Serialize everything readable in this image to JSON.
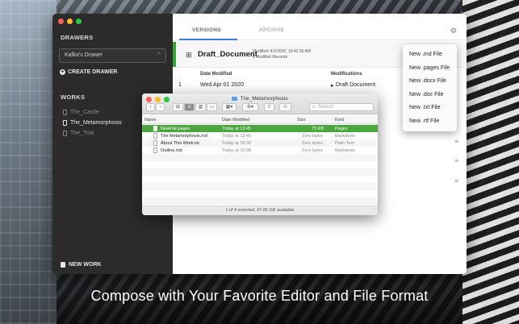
{
  "sidebar": {
    "drawers_heading": "DRAWERS",
    "drawer_selected": "Kafka's Drawer",
    "create_drawer": "CREATE DRAWER",
    "works_heading": "WORKS",
    "works": [
      "The_Castle",
      "The_Metamorphosis",
      "The_Trial"
    ],
    "active_work_index": 1,
    "new_work": "NEW WORK"
  },
  "tabs": {
    "versions": "VERSIONS",
    "archive": "ARCHIVE"
  },
  "document": {
    "title": "Draft_Document",
    "modified": "Modified: 4/1/2020, 10:42:30 AM",
    "records": "2 Modified Records",
    "accent_color": "#34a43a"
  },
  "table": {
    "col_date": "Date Modified",
    "col_mods": "Modifications",
    "row1": {
      "index": "1",
      "date": "Wed Apr 01 2020",
      "mod": "Draft Document"
    }
  },
  "format_menu": {
    "items": [
      "New .md File",
      "New .pages File",
      "New .docx File",
      "New .doc File",
      "New .txt File",
      "New .rtf File"
    ]
  },
  "finder": {
    "title": "The_Metamorphosis",
    "search_placeholder": "Search",
    "columns": {
      "name": "Name",
      "date": "Date Modified",
      "size": "Size",
      "kind": "Kind"
    },
    "files": [
      {
        "name": "NewFile.pages",
        "date": "Today at 13:45",
        "size": "73 KB",
        "kind": "Pages"
      },
      {
        "name": "The Metamorphosis.md",
        "date": "Today at 13:45",
        "size": "Zero bytes",
        "kind": "Markdown"
      },
      {
        "name": "About This Work.txt",
        "date": "Today at 10:30",
        "size": "Zero bytes",
        "kind": "Plain Text"
      },
      {
        "name": "Outline.md",
        "date": "Today at 10:30",
        "size": "Zero bytes",
        "kind": "Markdown"
      }
    ],
    "status": "1 of 4 selected, 47.86 GB available",
    "selection_color": "#4aa63d"
  },
  "caption": "Compose with Your Favorite Editor and File Format"
}
